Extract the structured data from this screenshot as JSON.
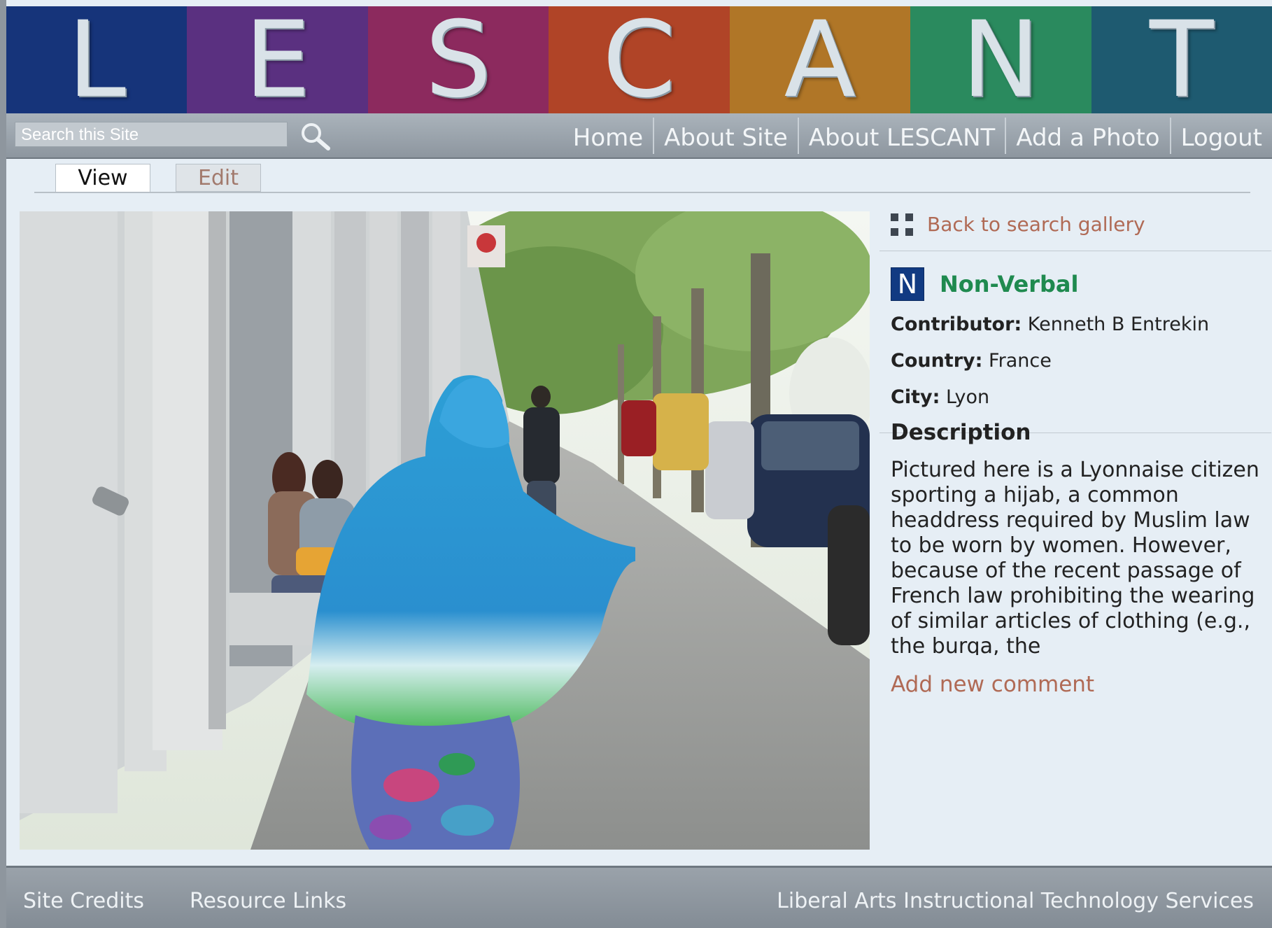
{
  "banner": {
    "letters": [
      "L",
      "E",
      "S",
      "C",
      "A",
      "N",
      "T"
    ],
    "colors": [
      "#16347a",
      "#5a3080",
      "#8c2a5e",
      "#b04427",
      "#b07627",
      "#2a8a5e",
      "#1e5a70"
    ]
  },
  "search": {
    "placeholder": "Search this Site",
    "icon": "search-icon"
  },
  "nav": {
    "items": [
      "Home",
      "About Site",
      "About LESCANT",
      "Add a Photo",
      "Logout"
    ]
  },
  "tabs": {
    "view": "View",
    "edit": "Edit",
    "active": "View"
  },
  "sidebar": {
    "back_link": "Back to search gallery",
    "back_icon": "grid-icon",
    "badge": "N",
    "category": "Non-Verbal",
    "contributor_label": "Contributor:",
    "contributor": "Kenneth B Entrekin",
    "country_label": "Country:",
    "country": "France",
    "city_label": "City:",
    "city": "Lyon",
    "description_heading": "Description",
    "description": "Pictured here is a Lyonnaise citizen sporting a hijab, a common headdress required by Muslim law to be worn by women. However, because of the recent passage of French law prohibiting the wearing of similar articles of clothing (e.g., the burqa, the",
    "add_comment": "Add new comment"
  },
  "footer": {
    "credits": "Site Credits",
    "links": "Resource Links",
    "org": "Liberal Arts Instructional Technology Services"
  }
}
